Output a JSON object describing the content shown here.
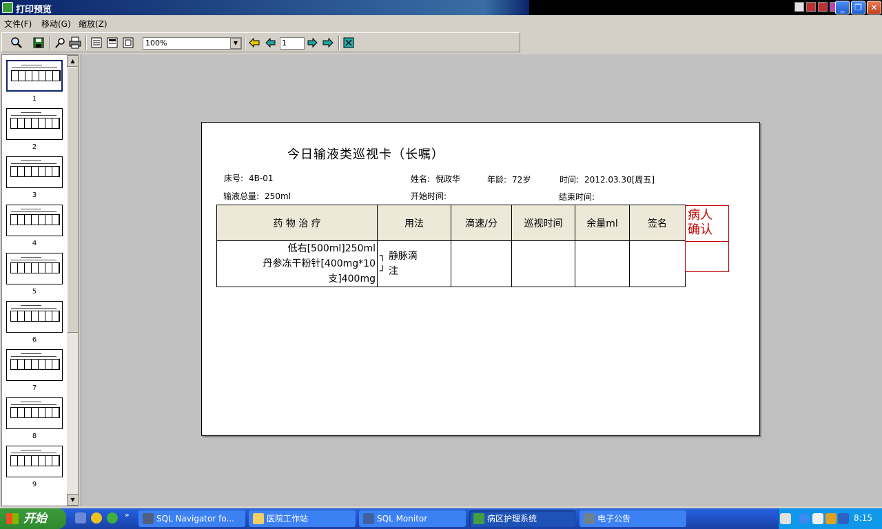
{
  "window": {
    "title": "打印预览"
  },
  "menu": {
    "items": [
      "文件(F)",
      "移动(G)",
      "缩放(Z)"
    ]
  },
  "toolbar": {
    "zoom_value": "100%",
    "page_number": "1"
  },
  "thumbnails": {
    "pages": [
      "1",
      "2",
      "3",
      "4",
      "5",
      "6",
      "7",
      "8",
      "9"
    ]
  },
  "document": {
    "title": "今日输液类巡视卡（长嘱）",
    "bed_label": "床号:",
    "bed_value": "4B-01",
    "name_label": "姓名:",
    "name_value": "倪政华",
    "age_label": "年龄:",
    "age_value": "72岁",
    "time_label": "时间:",
    "time_value": "2012.03.30[周五]",
    "total_label": "输液总量:",
    "total_value": "250ml",
    "start_label": "开始时间:",
    "end_label": "结束时间:",
    "table_headers": [
      "药 物 治 疗",
      "用法",
      "滴速/分",
      "巡视时间",
      "余量ml",
      "签名"
    ],
    "drugs": [
      "低右[500ml]250ml",
      "丹参冻干粉针[400mg*10支]400mg"
    ],
    "usage_lines": [
      "静脉滴",
      "注"
    ],
    "confirm_line1": "病人",
    "confirm_line2": "确认"
  },
  "taskbar": {
    "start_label": "开始",
    "tasks": [
      "SQL Navigator fo...",
      "医院工作站",
      "SQL Monitor",
      "病区护理系统",
      "电子公告"
    ],
    "clock": "8:15"
  }
}
